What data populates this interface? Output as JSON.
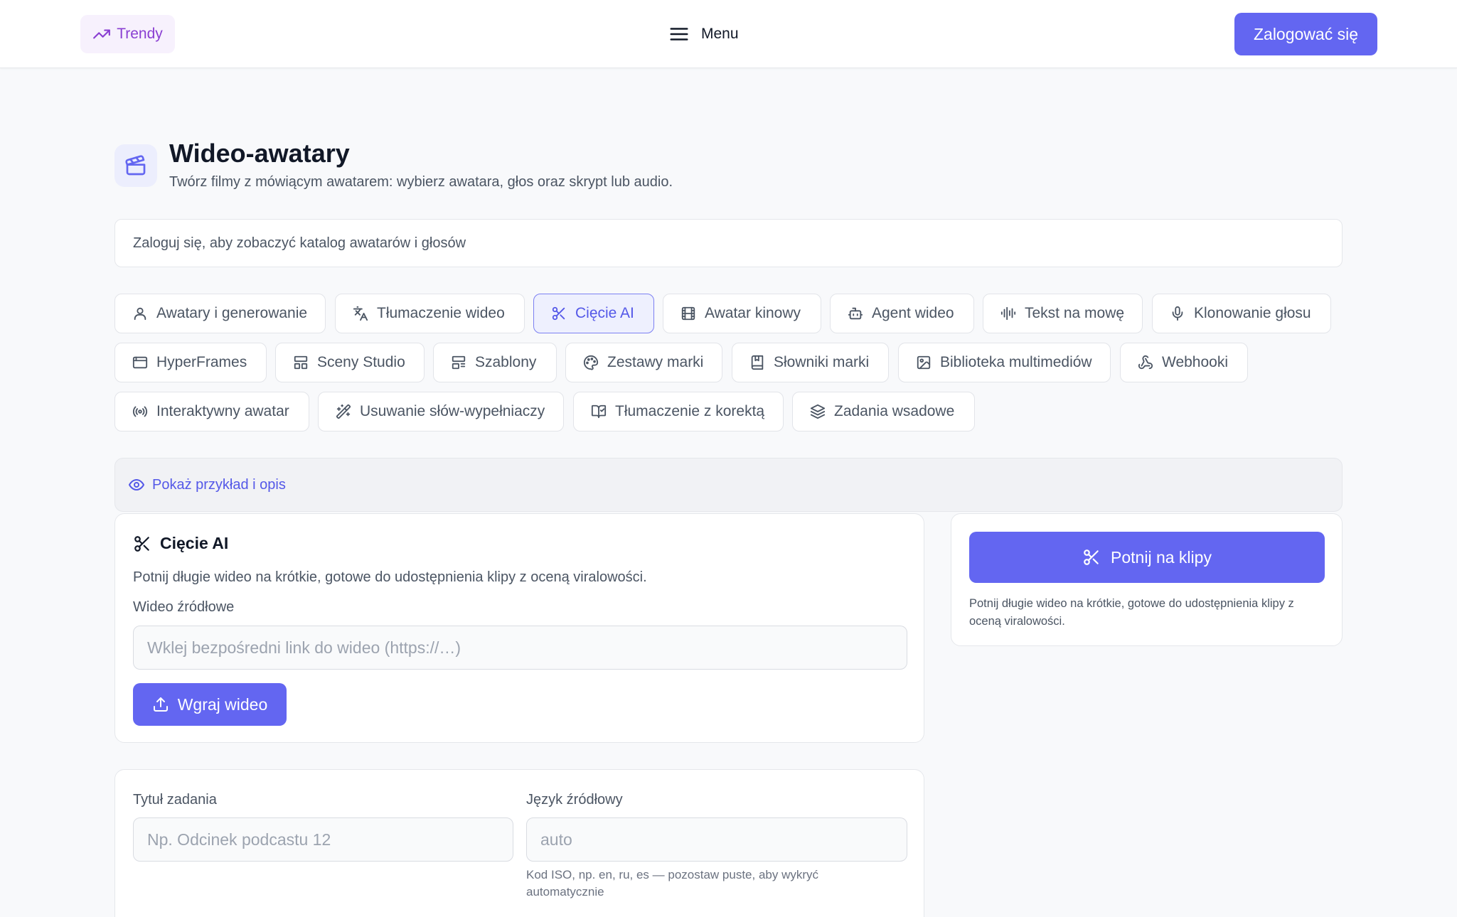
{
  "header": {
    "trend_label": "Trendy",
    "menu_label": "Menu",
    "login_label": "Zalogować się"
  },
  "page": {
    "title": "Wideo-awatary",
    "subtitle": "Twórz filmy z mówiącym awatarem: wybierz awatara, głos oraz skrypt lub audio.",
    "login_notice": "Zaloguj się, aby zobaczyć katalog awatarów i głosów"
  },
  "tabs": [
    {
      "label": "Awatary i generowanie",
      "icon": "user-icon"
    },
    {
      "label": "Tłumaczenie wideo",
      "icon": "translate-icon"
    },
    {
      "label": "Cięcie AI",
      "icon": "scissors-icon",
      "active": true
    },
    {
      "label": "Awatar kinowy",
      "icon": "film-icon"
    },
    {
      "label": "Agent wideo",
      "icon": "bot-icon"
    },
    {
      "label": "Tekst na mowę",
      "icon": "audio-wave-icon"
    },
    {
      "label": "Klonowanie głosu",
      "icon": "microphone-icon"
    },
    {
      "label": "HyperFrames",
      "icon": "browser-window-icon"
    },
    {
      "label": "Sceny Studio",
      "icon": "layout-icon"
    },
    {
      "label": "Szablony",
      "icon": "template-icon"
    },
    {
      "label": "Zestawy marki",
      "icon": "palette-icon"
    },
    {
      "label": "Słowniki marki",
      "icon": "book-icon"
    },
    {
      "label": "Biblioteka multimediów",
      "icon": "image-icon"
    },
    {
      "label": "Webhooki",
      "icon": "webhook-icon"
    },
    {
      "label": "Interaktywny awatar",
      "icon": "broadcast-icon"
    },
    {
      "label": "Usuwanie słów-wypełniaczy",
      "icon": "magic-wand-icon"
    },
    {
      "label": "Tłumaczenie z korektą",
      "icon": "book-check-icon"
    },
    {
      "label": "Zadania wsadowe",
      "icon": "layers-icon"
    }
  ],
  "example": {
    "label": "Pokaż przykład i opis"
  },
  "cut_card": {
    "title": "Cięcie AI",
    "description": "Potnij długie wideo na krótkie, gotowe do udostępnienia klipy z oceną viralowości.",
    "source_label": "Wideo źródłowe",
    "source_placeholder": "Wklej bezpośredni link do wideo (https://…)",
    "upload_label": "Wgraj wideo"
  },
  "side_card": {
    "action_label": "Potnij na klipy",
    "description": "Potnij długie wideo na krótkie, gotowe do udostępnienia klipy z oceną viralowości."
  },
  "job_card": {
    "title_label": "Tytuł zadania",
    "title_placeholder": "Np. Odcinek podcastu 12",
    "language_label": "Język źródłowy",
    "language_placeholder": "auto",
    "language_hint": "Kod ISO, np. en, ru, es — pozostaw puste, aby wykryć automatycznie"
  },
  "colors": {
    "accent": "#6366f1",
    "accent_text": "#5458e8",
    "trend": "#8a3fd2"
  }
}
